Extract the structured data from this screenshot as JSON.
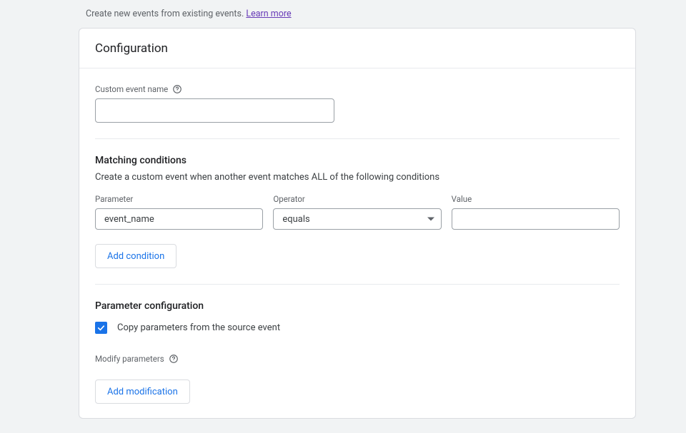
{
  "intro": {
    "text": "Create new events from existing events.",
    "link": "Learn more"
  },
  "card": {
    "title": "Configuration"
  },
  "customEvent": {
    "label": "Custom event name",
    "value": ""
  },
  "matching": {
    "title": "Matching conditions",
    "description": "Create a custom event when another event matches ALL of the following conditions",
    "columns": {
      "parameter": "Parameter",
      "operator": "Operator",
      "value": "Value"
    },
    "row": {
      "parameter": "event_name",
      "operator": "equals",
      "value": ""
    },
    "addButton": "Add condition"
  },
  "paramConfig": {
    "title": "Parameter configuration",
    "copyCheckbox": {
      "checked": true,
      "label": "Copy parameters from the source event"
    },
    "modifyLabel": "Modify parameters",
    "addButton": "Add modification"
  }
}
